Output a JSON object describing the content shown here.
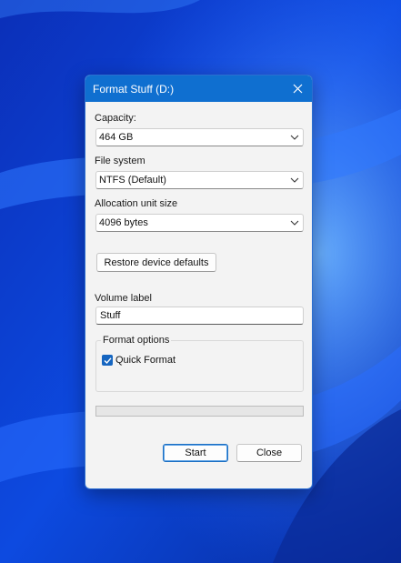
{
  "dialog": {
    "title": "Format Stuff (D:)",
    "close_icon": "close-icon"
  },
  "capacity": {
    "label": "Capacity:",
    "value": "464 GB"
  },
  "file_system": {
    "label": "File system",
    "value": "NTFS (Default)"
  },
  "allocation": {
    "label": "Allocation unit size",
    "value": "4096 bytes"
  },
  "restore_button": {
    "label": "Restore device defaults"
  },
  "volume_label": {
    "label": "Volume label",
    "value": "Stuff"
  },
  "format_options": {
    "title": "Format options",
    "quick_format": {
      "label": "Quick Format",
      "checked": true
    }
  },
  "progress": {
    "value": 0
  },
  "buttons": {
    "start": "Start",
    "close": "Close"
  },
  "colors": {
    "titlebar": "#0f6fd0",
    "dialog_bg": "#f3f3f3",
    "accent": "#1565c0",
    "wallpaper": "#0a3fd6"
  }
}
